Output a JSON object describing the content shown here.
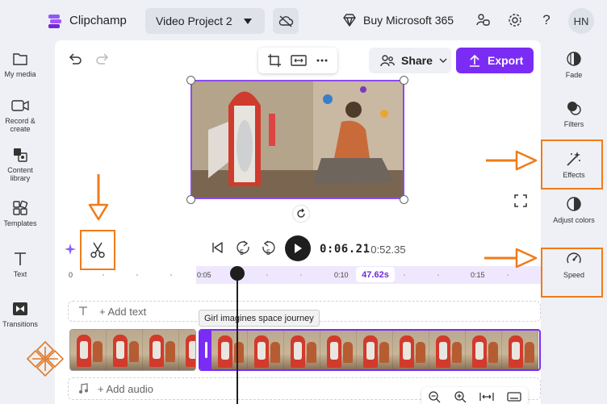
{
  "topbar": {
    "app_name": "Clipchamp",
    "project_name": "Video Project 2",
    "buy_label": "Buy Microsoft 365",
    "avatar_initials": "HN",
    "help_label": "?"
  },
  "left_sidebar": {
    "items": [
      {
        "label": "My media",
        "icon": "folder-icon"
      },
      {
        "label": "Record & create",
        "icon": "camera-icon"
      },
      {
        "label": "Content library",
        "icon": "library-icon"
      },
      {
        "label": "Templates",
        "icon": "templates-icon"
      },
      {
        "label": "Text",
        "icon": "text-icon"
      },
      {
        "label": "Transitions",
        "icon": "transitions-icon"
      }
    ]
  },
  "right_sidebar": {
    "items": [
      {
        "label": "Fade",
        "icon": "fade-icon"
      },
      {
        "label": "Filters",
        "icon": "filters-icon"
      },
      {
        "label": "Effects",
        "icon": "magic-wand-icon"
      },
      {
        "label": "Adjust colors",
        "icon": "adjust-colors-icon"
      },
      {
        "label": "Speed",
        "icon": "speedometer-icon"
      }
    ]
  },
  "editor": {
    "share_label": "Share",
    "export_label": "Export"
  },
  "playback": {
    "current_time": "0:06.21",
    "total_time": "/ 0:52.35",
    "skip_back_label": "5",
    "skip_fwd_label": "5"
  },
  "timeline": {
    "ruler_zero": "0",
    "ruler_labels": [
      "0:05",
      "0:10",
      "0:15"
    ],
    "selection_duration": "47.62s",
    "add_text_label": "+ Add text",
    "add_audio_label": "+ Add audio",
    "clip_tooltip": "Girl imagines space journey"
  },
  "colors": {
    "accent": "#7a2cf5",
    "annotation": "#f07b1a"
  }
}
